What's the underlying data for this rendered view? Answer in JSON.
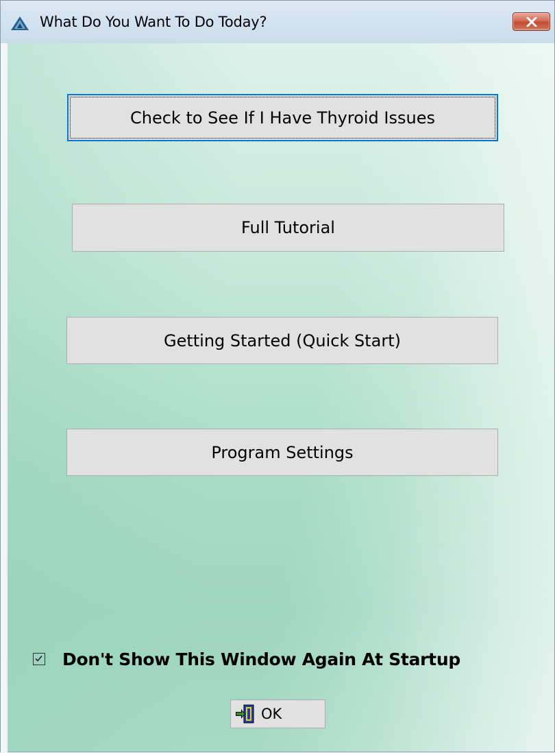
{
  "window": {
    "title": "What Do You Want To Do Today?"
  },
  "buttons": {
    "check_thyroid": "Check to See If I Have Thyroid Issues",
    "full_tutorial": "Full Tutorial",
    "getting_started": "Getting Started (Quick Start)",
    "program_settings": "Program Settings"
  },
  "startup_option": {
    "label": "Don't Show This Window Again At Startup",
    "checked": true
  },
  "ok_button": {
    "label": "OK"
  },
  "icons": {
    "app": "app-triangle-icon",
    "close": "close-icon",
    "ok": "exit-door-icon"
  },
  "colors": {
    "focus_border": "#0078d7",
    "close_button": "#c24a33",
    "background_green": "#a9dcc8"
  }
}
